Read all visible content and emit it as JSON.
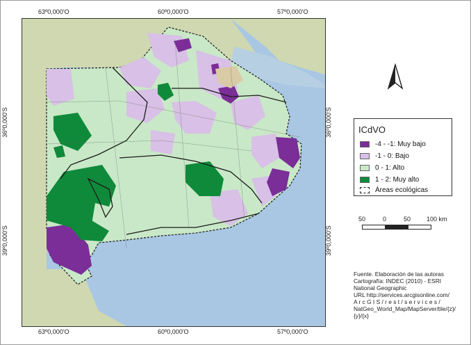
{
  "map": {
    "coords_top": [
      "63º0,000'O",
      "60º0,000'O",
      "57º0,000'O"
    ],
    "coords_bottom": [
      "63º0,000'O",
      "60º0,000'O",
      "57º0,000'O"
    ],
    "coords_left": [
      "36º0,000'S",
      "39º0,000'S"
    ],
    "coords_right": [
      "36º0,000'S",
      "39º0,000'S"
    ],
    "colors": {
      "ocean": "#a9c7e3",
      "land": "#cfd8b0",
      "muy_bajo": "#7b2d98",
      "bajo": "#d8c0e6",
      "alto": "#c9e8c7",
      "muy_alto": "#0f8a3a",
      "boundary": "#1b1b1b"
    }
  },
  "legend": {
    "title": "ICdVO",
    "items": [
      {
        "label": "-4 - -1: Muy bajo",
        "color": "#7b2d98"
      },
      {
        "label": "-1 - 0: Bajo",
        "color": "#d8c0e6"
      },
      {
        "label": "0 - 1: Alto",
        "color": "#c9e8c7"
      },
      {
        "label": "1 - 2: Muy alto",
        "color": "#0f8a3a"
      },
      {
        "label": "Áreas ecológicas",
        "color": "#ffffff"
      }
    ]
  },
  "scale": {
    "labels": [
      "50",
      "0",
      "50",
      "100 km"
    ]
  },
  "north_arrow": {
    "icon": "north-arrow-icon"
  },
  "source": {
    "lines": [
      "Fuente. Elaboración de las autoras",
      "Cartografía:  INDEC  (2010)  -  ESRI",
      "National Geographic",
      "URL      http://services.arcgisonline.com/",
      "A r c G I S / r e s t / s e r v i c e s /",
      "NatGeo_World_Map/MapServer/tile/{z}/",
      "{y}/{x}"
    ]
  }
}
